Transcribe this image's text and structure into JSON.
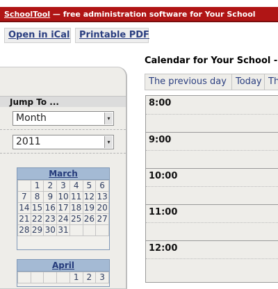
{
  "header": {
    "app_name": "SchoolTool",
    "tagline": " — free administration software for Your School"
  },
  "toolbar": {
    "ical_label": "Open in iCal",
    "pdf_label": "Printable PDF"
  },
  "sidebar": {
    "jump_label": "Jump To ...",
    "month_select": {
      "value": "Month",
      "arrow": "▾"
    },
    "year_select": {
      "value": "2011",
      "arrow": "▾"
    },
    "calendars": [
      {
        "month": "March",
        "weeks": [
          [
            "",
            "",
            "1",
            "2",
            "3",
            "4",
            "5",
            "6"
          ],
          [
            "7",
            "8",
            "9",
            "10",
            "11",
            "12",
            "13"
          ],
          [
            "14",
            "15",
            "16",
            "17",
            "18",
            "19",
            "20"
          ],
          [
            "21",
            "22",
            "23",
            "24",
            "25",
            "26",
            "27"
          ],
          [
            "28",
            "29",
            "30",
            "31",
            "",
            "",
            ""
          ]
        ]
      },
      {
        "month": "April",
        "weeks": [
          [
            "",
            "",
            "",
            "",
            "1",
            "2",
            "3"
          ]
        ]
      }
    ]
  },
  "main": {
    "title": "Calendar for Your School -",
    "nav": {
      "previous": "The previous day",
      "today": "Today",
      "next": "Th"
    },
    "hours": [
      "8:00",
      "9:00",
      "10:00",
      "11:00",
      "12:00"
    ]
  }
}
